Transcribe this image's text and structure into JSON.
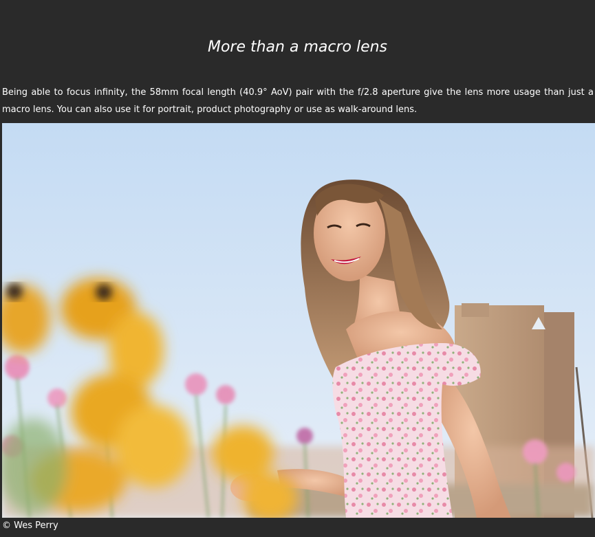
{
  "article": {
    "heading": "More than a macro lens",
    "intro": "Being able to focus infinity, the 58mm focal length (40.9° AoV) pair with the f/2.8 aperture give the lens more usage than just a macro lens. You can also use it for portrait, product photography or use as walk-around lens.",
    "credit": "© Wes Perry"
  },
  "colors": {
    "background": "#2a2a2a",
    "text": "#ffffff",
    "sky": "#c9def4"
  }
}
